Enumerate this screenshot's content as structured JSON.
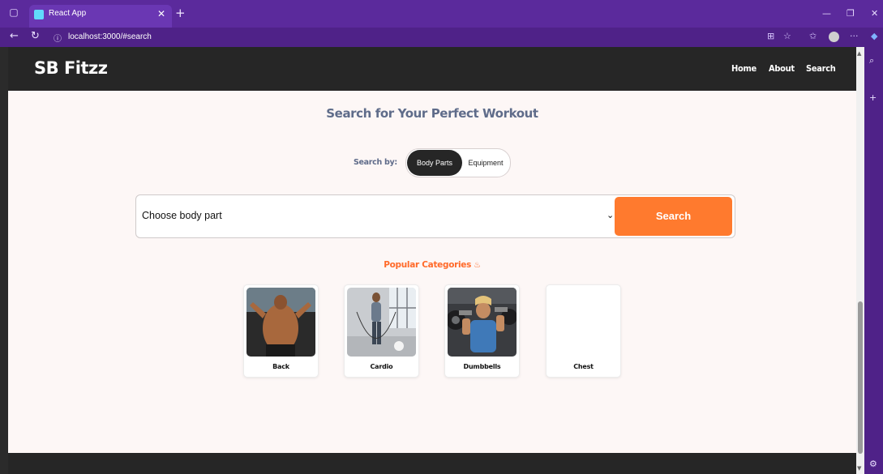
{
  "browser": {
    "tab_title": "React App",
    "url": "localhost:3000/#search"
  },
  "navbar": {
    "logo": "SB Fitzz",
    "links": [
      "Home",
      "About",
      "Search"
    ]
  },
  "search": {
    "heading": "Search for Your Perfect Workout",
    "search_by_label": "Search by:",
    "toggle_options": [
      "Body Parts",
      "Equipment"
    ],
    "selected_toggle": "Body Parts",
    "select_value": "Choose body part",
    "button_label": "Search"
  },
  "popular": {
    "title": "Popular Categories",
    "categories": [
      {
        "label": "Back",
        "image": "back-photo"
      },
      {
        "label": "Cardio",
        "image": "cardio-photo"
      },
      {
        "label": "Dumbbells",
        "image": "dumbbells-photo"
      },
      {
        "label": "Chest",
        "image": "none"
      }
    ]
  },
  "colors": {
    "accent": "#ff7a2e",
    "navbar": "#262626",
    "heading": "#5f6c8a",
    "page_bg": "#fdf7f6",
    "browser_chrome": "#5b2a9c"
  }
}
